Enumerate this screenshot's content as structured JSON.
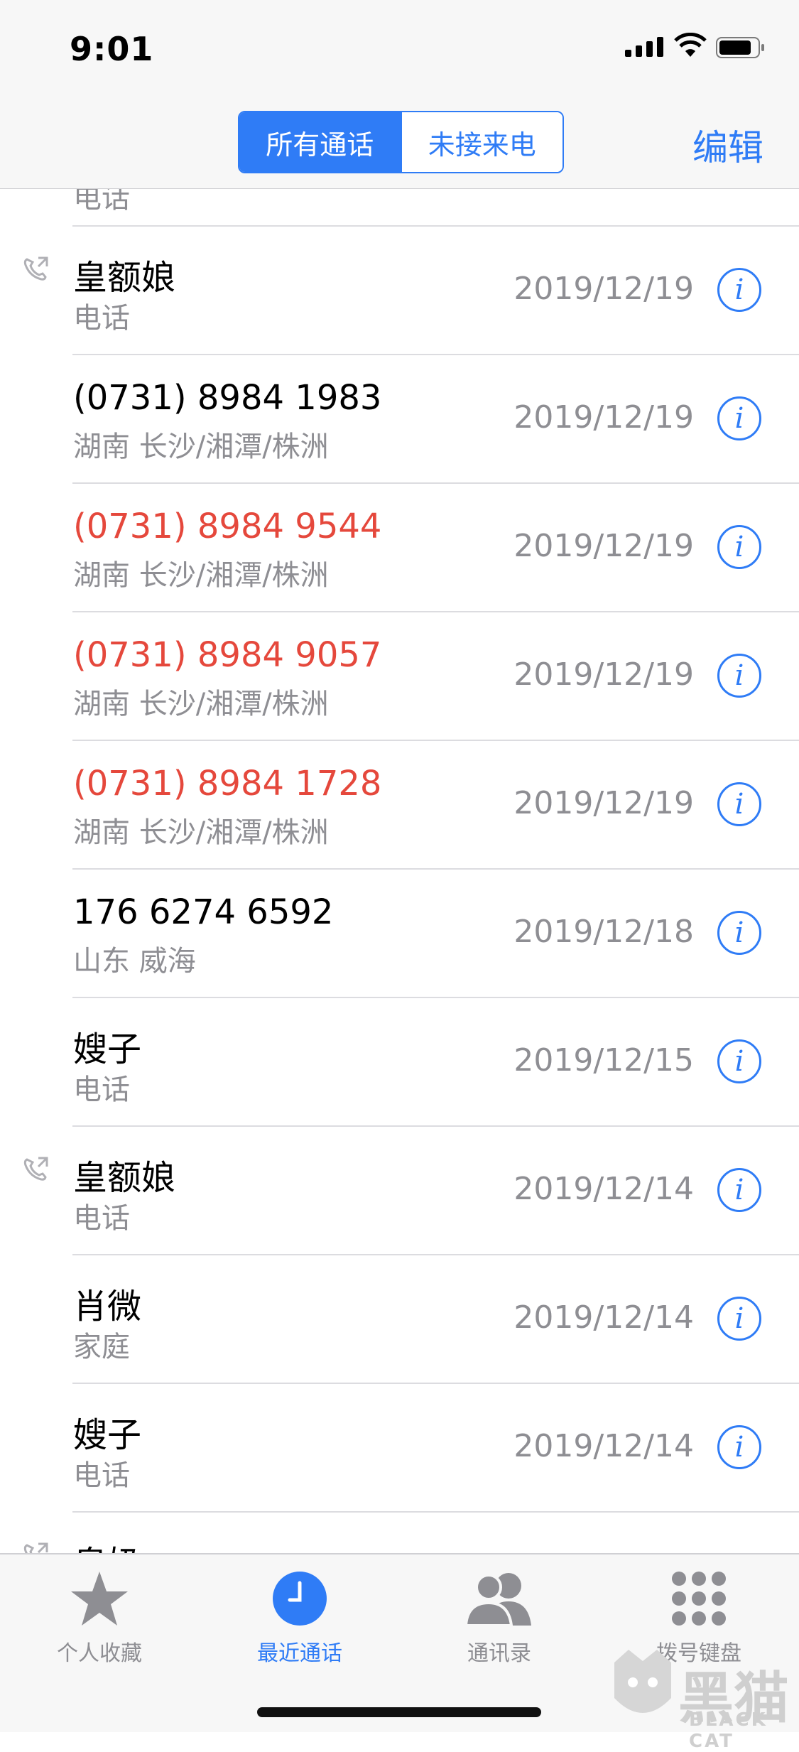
{
  "status": {
    "time": "9:01"
  },
  "nav": {
    "segments": [
      "所有通话",
      "未接来电"
    ],
    "edit_label": "编辑"
  },
  "partial_row": {
    "sub": "电话"
  },
  "calls": [
    {
      "name": "皇额娘",
      "sub": "电话",
      "date": "2019/12/19",
      "missed": false,
      "outgoing": true
    },
    {
      "name": "(0731) 8984 1983",
      "sub": "湖南 长沙/湘潭/株洲",
      "date": "2019/12/19",
      "missed": false,
      "outgoing": false
    },
    {
      "name": "(0731) 8984 9544",
      "sub": "湖南 长沙/湘潭/株洲",
      "date": "2019/12/19",
      "missed": true,
      "outgoing": false
    },
    {
      "name": "(0731) 8984 9057",
      "sub": "湖南 长沙/湘潭/株洲",
      "date": "2019/12/19",
      "missed": true,
      "outgoing": false
    },
    {
      "name": "(0731) 8984 1728",
      "sub": "湖南 长沙/湘潭/株洲",
      "date": "2019/12/19",
      "missed": true,
      "outgoing": false
    },
    {
      "name": "176 6274 6592",
      "sub": "山东 威海",
      "date": "2019/12/18",
      "missed": false,
      "outgoing": false
    },
    {
      "name": "嫂子",
      "sub": "电话",
      "date": "2019/12/15",
      "missed": false,
      "outgoing": false
    },
    {
      "name": "皇额娘",
      "sub": "电话",
      "date": "2019/12/14",
      "missed": false,
      "outgoing": true
    },
    {
      "name": "肖微",
      "sub": "家庭",
      "date": "2019/12/14",
      "missed": false,
      "outgoing": false
    },
    {
      "name": "嫂子",
      "sub": "电话",
      "date": "2019/12/14",
      "missed": false,
      "outgoing": false
    },
    {
      "name": "皇奶",
      "sub": "",
      "date": "",
      "missed": false,
      "outgoing": true
    }
  ],
  "tabs": [
    {
      "label": "个人收藏",
      "icon": "star-icon",
      "active": false
    },
    {
      "label": "最近通话",
      "icon": "clock-icon",
      "active": true
    },
    {
      "label": "通讯录",
      "icon": "contacts-icon",
      "active": false
    },
    {
      "label": "拨号键盘",
      "icon": "keypad-icon",
      "active": false
    }
  ],
  "watermark": {
    "main": "黑猫",
    "sub": "BLACK CAT"
  },
  "colors": {
    "accent": "#2f7cf6",
    "missed": "#e5483c",
    "secondary": "#8e8e93"
  }
}
